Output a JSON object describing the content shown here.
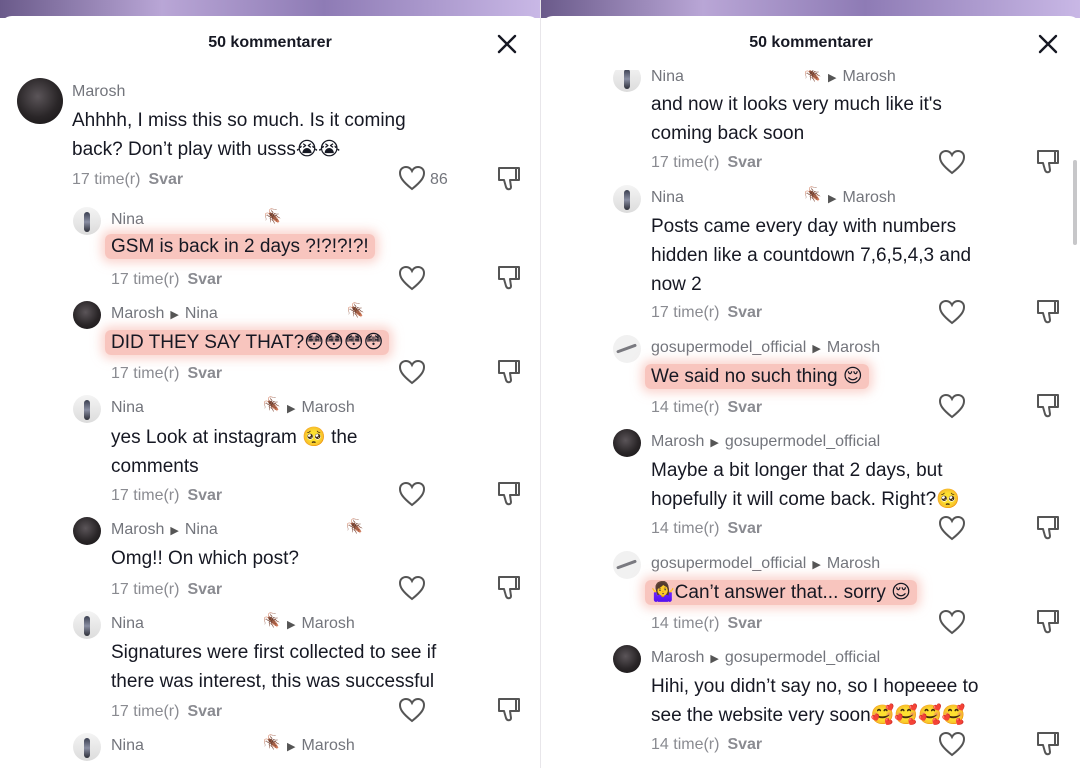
{
  "left": {
    "title": "50 kommentarer",
    "comments": [
      {
        "name": "Marosh",
        "text_line1": "Ahhhh, I miss this so much. Is it coming",
        "text_line2": "back? Don’t play with usss😭😭",
        "time": "17 time(r)",
        "reply": "Svar",
        "likes": "86"
      },
      {
        "name": "Nina",
        "text": "GSM is back in 2 days ?!?!?!?!",
        "time": "17 time(r)",
        "reply": "Svar"
      },
      {
        "name": "Marosh",
        "to": "Nina",
        "text": "DID THEY SAY THAT?😳😳😳😳",
        "time": "17 time(r)",
        "reply": "Svar"
      },
      {
        "name": "Nina",
        "to": "Marosh",
        "text_line1": "yes Look at instagram 🥺 the",
        "text_line2": "comments",
        "time": "17 time(r)",
        "reply": "Svar"
      },
      {
        "name": "Marosh",
        "to": "Nina",
        "text": "Omg!! On which post?",
        "time": "17 time(r)",
        "reply": "Svar"
      },
      {
        "name": "Nina",
        "to": "Marosh",
        "text_line1": "Signatures were first collected to see if",
        "text_line2": "there was interest, this was successful",
        "time": "17 time(r)",
        "reply": "Svar"
      },
      {
        "name": "Nina",
        "to": "Marosh"
      }
    ]
  },
  "right": {
    "title": "50 kommentarer",
    "comments": [
      {
        "name": "Nina",
        "to": "Marosh",
        "text_line1": "and now it looks very much like it's",
        "text_line2": "coming back soon",
        "time": "17 time(r)",
        "reply": "Svar"
      },
      {
        "name": "Nina",
        "to": "Marosh",
        "text_line1": "Posts came every day with numbers",
        "text_line2": "hidden like a countdown 7,6,5,4,3 and",
        "text_line3": "now 2",
        "time": "17 time(r)",
        "reply": "Svar"
      },
      {
        "name": "gosupermodel_official",
        "to": "Marosh",
        "text": "We said no such thing 😌",
        "time": "14 time(r)",
        "reply": "Svar"
      },
      {
        "name": "Marosh",
        "to": "gosupermodel_official",
        "text_line1": "Maybe a bit longer that 2 days, but",
        "text_line2": "hopefully it will come back. Right?🥺",
        "time": "14 time(r)",
        "reply": "Svar"
      },
      {
        "name": "gosupermodel_official",
        "to": "Marosh",
        "text": "🤷‍♀️Can’t answer that... sorry 😌",
        "time": "14 time(r)",
        "reply": "Svar"
      },
      {
        "name": "Marosh",
        "to": "gosupermodel_official",
        "text_line1": "Hihi, you didn’t say no, so I hopeeee to",
        "text_line2": "see the website very soon🥰🥰🥰🥰",
        "time": "14 time(r)",
        "reply": "Svar"
      }
    ]
  },
  "icons": {
    "close": "close-icon",
    "heart": "heart-icon",
    "dislike": "dislike-icon",
    "bug": "bug-icon"
  },
  "colors": {
    "highlight": "#f6b2a8",
    "meta": "#8a8b91",
    "text": "#161823"
  }
}
